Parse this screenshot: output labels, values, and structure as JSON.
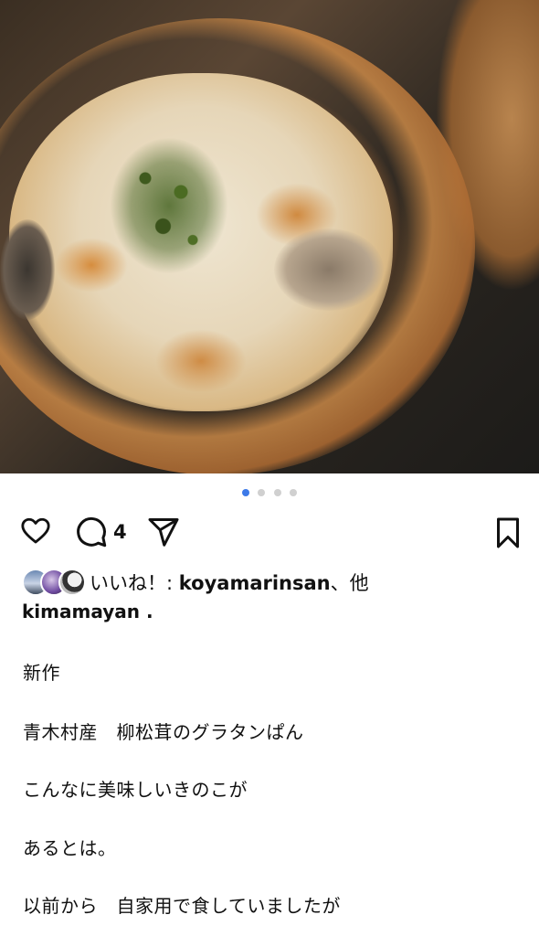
{
  "post": {
    "image_alt": "Gratin bread with mushrooms and herbs",
    "carousel": {
      "total": 4,
      "active_index": 0
    }
  },
  "actions": {
    "like_icon": "heart-icon",
    "comment_icon": "comment-icon",
    "comment_count": "4",
    "share_icon": "paper-plane-icon",
    "save_icon": "bookmark-icon"
  },
  "likes": {
    "prefix": "いいね！: ",
    "user": "koyamarinsan",
    "suffix": "、他"
  },
  "caption": {
    "username": "kimamayan .",
    "lines": [
      "新作",
      "青木村産　柳松茸のグラタンぱん",
      "こんなに美味しいきのこが",
      "あるとは。",
      "以前から　自家用で食していましたが"
    ]
  },
  "colors": {
    "accent_dot": "#3d7ae8",
    "inactive_dot": "#d0d0d0",
    "text": "#111111"
  }
}
